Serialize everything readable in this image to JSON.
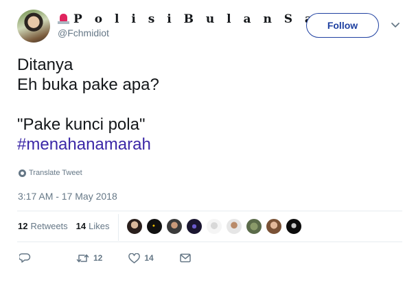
{
  "user": {
    "display_name": "P o l i s i  B u l a n  S a b …",
    "handle": "@Fchmidiot",
    "avatar_icon": "user-avatar-photo"
  },
  "follow_button": {
    "label": "Follow"
  },
  "tweet": {
    "lines": [
      "Ditanya",
      "Eh buka pake apa?",
      "",
      "\"Pake kunci pola\""
    ],
    "hashtag": "#menahanamarah",
    "translate_label": "Translate Tweet",
    "timestamp": "3:17 AM - 17 May 2018"
  },
  "stats": {
    "retweets_count": "12",
    "retweets_label": "Retweets",
    "likes_count": "14",
    "likes_label": "Likes"
  },
  "actions": {
    "reply_icon": "reply-icon",
    "retweet_icon": "retweet-icon",
    "retweet_count": "12",
    "like_icon": "heart-icon",
    "like_count": "14",
    "message_icon": "envelope-icon"
  },
  "colors": {
    "follow_accent": "#1d3fa0",
    "hashtag": "#3b27a7",
    "muted": "#657786"
  }
}
